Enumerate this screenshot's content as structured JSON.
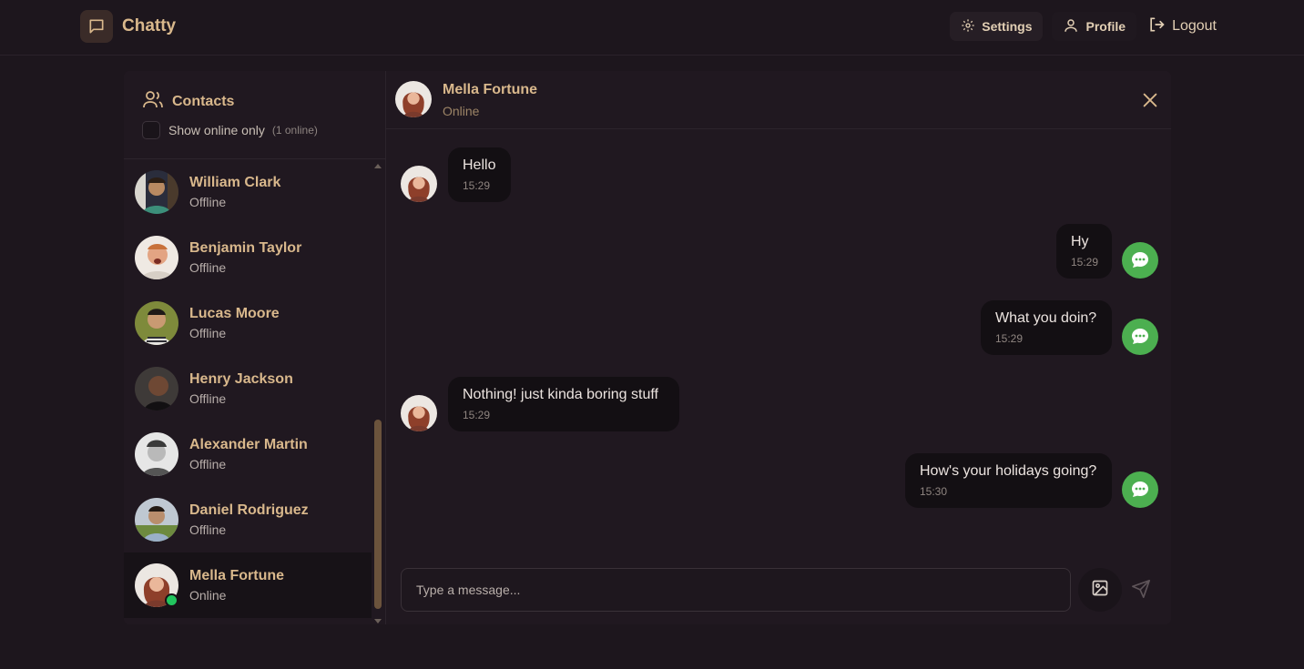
{
  "app": {
    "title": "Chatty"
  },
  "nav": {
    "settings": "Settings",
    "profile": "Profile",
    "logout": "Logout"
  },
  "sidebar": {
    "title": "Contacts",
    "filter_label": "Show online only",
    "online_count": "(1 online)",
    "contacts": [
      {
        "name": "William Clark",
        "status": "Offline"
      },
      {
        "name": "Benjamin Taylor",
        "status": "Offline"
      },
      {
        "name": "Lucas Moore",
        "status": "Offline"
      },
      {
        "name": "Henry Jackson",
        "status": "Offline"
      },
      {
        "name": "Alexander Martin",
        "status": "Offline"
      },
      {
        "name": "Daniel Rodriguez",
        "status": "Offline"
      },
      {
        "name": "Mella Fortune",
        "status": "Online",
        "selected": true
      }
    ]
  },
  "chat": {
    "contact_name": "Mella Fortune",
    "contact_status": "Online",
    "messages": [
      {
        "from": "them",
        "text": "Hello",
        "time": "15:29"
      },
      {
        "from": "me",
        "text": "Hy",
        "time": "15:29"
      },
      {
        "from": "me",
        "text": "What you doin?",
        "time": "15:29"
      },
      {
        "from": "them",
        "text": "Nothing! just kinda boring stuff",
        "time": "15:29"
      },
      {
        "from": "me",
        "text": "How's your holidays going?",
        "time": "15:30"
      }
    ],
    "input_placeholder": "Type a message..."
  },
  "colors": {
    "accent": "#d9b88c",
    "online": "#22c55e",
    "me_avatar": "#4caf50",
    "background": "#1d161d"
  },
  "icons": {
    "brand": "message-square-icon",
    "settings": "gear-icon",
    "profile": "user-icon",
    "logout": "logout-icon",
    "contacts": "users-icon",
    "close": "close-icon",
    "attach": "image-icon",
    "send": "send-icon",
    "me_avatar": "chat-bubble-dots-icon"
  }
}
